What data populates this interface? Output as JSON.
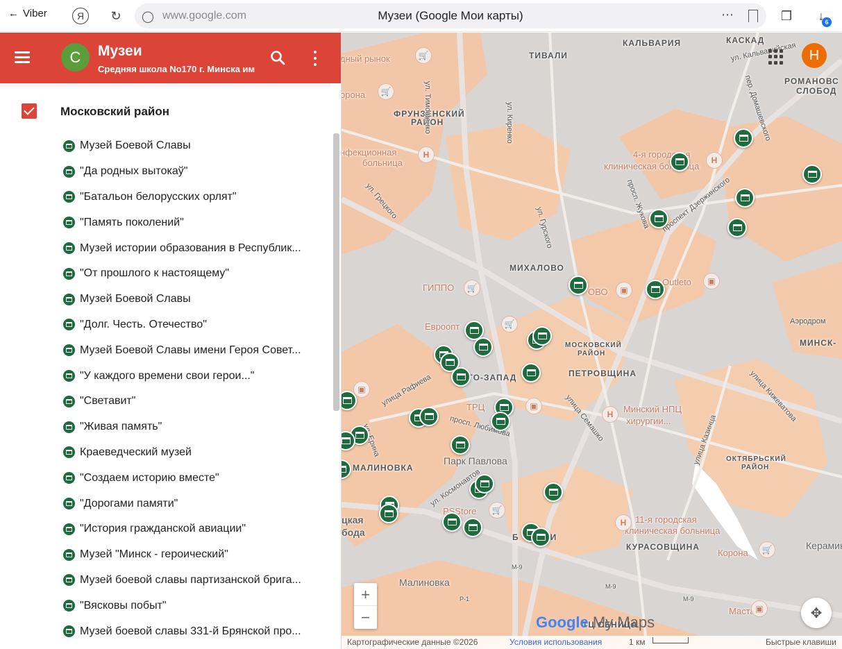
{
  "browser": {
    "back_label": "Viber",
    "url": "www.google.com",
    "page_title": "Музеи (Google Мои карты)",
    "ya_letter": "Я",
    "downloads_count": "6"
  },
  "panel": {
    "avatar_letter": "С",
    "title": "Музеи",
    "subtitle": "Средняя школа No170 г. Минска им",
    "layer_name": "Московский район",
    "items": [
      "Музей Боевой Славы",
      "\"Да родных вытокаў\"",
      "\"Батальон белорусских орлят\"",
      "\"Память поколений\"",
      "Музей истории образования в Республик...",
      "\"От прошлого к настоящему\"",
      "Музей Боевой Славы",
      "\"Долг. Честь. Отечество\"",
      "Музей Боевой Славы имени Героя Совет...",
      "\"У каждого времени свои герои...\"",
      "\"Светавит\"",
      "\"Живая память\"",
      "Краеведческий музей",
      "\"Создаем историю вместе\"",
      "\"Дорогами памяти\"",
      "\"История гражданской авиации\"",
      "Музей \"Минск - героический\"",
      "Музей боевой славы партизанской брига...",
      "\"Вясковы побыт\"",
      "Музей боевой славы 331-й Брянской про..."
    ]
  },
  "map": {
    "user_avatar_letter": "Н",
    "labels": {
      "tivali": "ТИВАЛИ",
      "kalvariya": "КАЛЬВАРИЯ",
      "kaskad": "КАСКАД",
      "kalvariyskaya": "ул. Кальварийская",
      "romanovskaya1": "РОМАНОВС",
      "romanovskaya2": "СЛОБОД",
      "frunzenskiy1": "ФРУНЗЕНСКИЙ",
      "frunzenskiy2": "РАЙОН",
      "timoshenko": "ул. Тимошенко",
      "kirenko": "ул. Киренко",
      "infbol1": "нфекционная",
      "infbol2": "больница",
      "gretskogo": "ул. Грецкого",
      "gorbol1": "4-я городская",
      "gorbol2": "клиническая больница",
      "domashevskogo": "пер. Домашевского",
      "zhukova": "просп. Жукова",
      "dzerzhinskogo": "проспект Дзержинского",
      "gurskogo": "ул. Гурского",
      "mikhalovo": "МИХАЛОВО",
      "gippo": "ГИППО",
      "outleto": "Outleto",
      "ovo": "ОВО",
      "aerodrom": "Аэродром",
      "minsk": "МИНСК-",
      "evroopt": "Евроопт",
      "moskovskiy1": "МОСКОВСКИЙ",
      "moskovskiy2": "РАЙОН",
      "petrovshchina": "ПЕТРОВЩИНА",
      "zapad": "ГО-ЗАПАД",
      "rafieva": "улица Рафиева",
      "semashko": "улица Семашко",
      "npc1": "Минский НПЦ",
      "npc2": "хирургии...",
      "kizhevatova": "улица Кижеватова",
      "trc": "ТРЦ",
      "lyubimova": "просп. Любимова",
      "erina": "ул. Ерина",
      "kaliy": "улица Казинца",
      "parkpavlova": "Парк Павлова",
      "malinovka": "МАЛИНОВКА",
      "oktyabrskiy1": "ОКТЯБРЬСКИЙ",
      "oktyabrskiy2": "РАЙОН",
      "kosmonavtov": "ул. Космонавтов",
      "pstore": "PSStore",
      "gorbol11a": "11-я городская",
      "gorbol11b": "клиническая больница",
      "tsk1": "цкая",
      "tsk2": "бода",
      "bkichi": "Б      ИЧИ",
      "kurasovshchina": "КУРАСОВЩИНА",
      "korona": "Корона",
      "keramin": "Керамин",
      "korona_top": "орона",
      "rynok": "дный рынок",
      "malinovka2": "Малиновка",
      "m9a": "М-9",
      "m9b": "М-9",
      "m9c": "М-9",
      "p1": "Р-1",
      "seniza": "ТЦ СЕНИЦА",
      "mastak": "Мастак"
    },
    "zoom_in": "+",
    "zoom_out": "−",
    "logo_google": "Google",
    "logo_mymaps": "My Maps",
    "attribution": "Картографические данные ©2026",
    "terms": "Условия использования",
    "scale_label": "1 км",
    "shortcuts": "Быстрые клавиши"
  }
}
